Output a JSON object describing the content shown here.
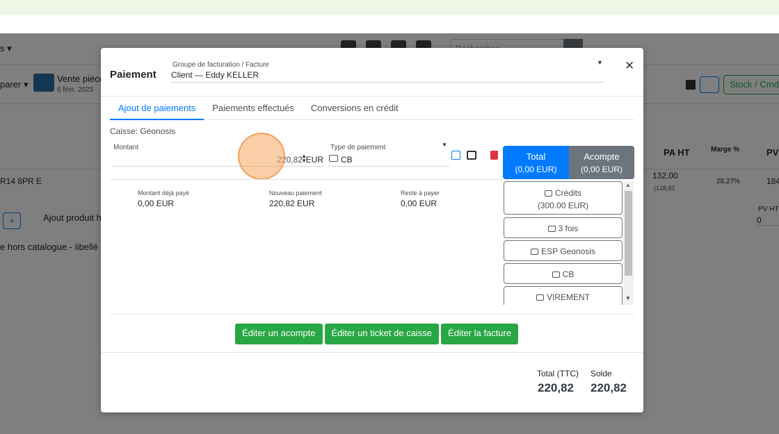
{
  "background": {
    "menu_label": "s ▾",
    "search_placeholder": "Rechercher",
    "comparer_label": "parer ▾",
    "vente_title": "Vente pièce",
    "vente_date": "6 févr. 2025",
    "stock_button": "Stock / Cmd",
    "columns": {
      "pa_ht": "PA HT",
      "marge": "Marge %",
      "pv": "PV"
    },
    "row": {
      "reference": "R14 8PR E",
      "pa_value": "132,00",
      "pa_sub": "(128,82",
      "marge_value": "28,27%",
      "pv_value": "184"
    },
    "ajout_produit": "Ajout produit h",
    "pv_ht_label": "PV HT",
    "pv_ht_value": "0",
    "hors_catalogue": "e hors catalogue - libellé"
  },
  "modal": {
    "title": "Paiement",
    "group_label": "Groupe de facturation / Facture",
    "group_value": "Client — Eddy KELLER",
    "close_icon": "close-icon",
    "tabs": [
      {
        "label": "Ajout de paiements",
        "active": true
      },
      {
        "label": "Paiements effectués",
        "active": false
      },
      {
        "label": "Conversions en crédit",
        "active": false
      }
    ],
    "caisse": "Caisse: Géonosis",
    "montant_label": "Montant",
    "montant_value": "220,82",
    "currency": "EUR",
    "type_label": "Type de paiement",
    "type_value": "CB",
    "total_button": {
      "label": "Total",
      "amount": "(0,00 EUR)"
    },
    "acompte_button": {
      "label": "Acompte",
      "amount": "(0,00 EUR)"
    },
    "summary": [
      {
        "label": "Montant déjà payé",
        "value": "0,00 EUR"
      },
      {
        "label": "Nouveau paiement",
        "value": "220,82 EUR"
      },
      {
        "label": "Reste à payer",
        "value": "0,00 EUR"
      }
    ],
    "payment_methods": [
      {
        "label": "Crédits",
        "sub": "(300.00 EUR)",
        "icon": "receipt-icon"
      },
      {
        "label": "3 fois",
        "icon": "card-icon"
      },
      {
        "label": "ESP Geonosis",
        "icon": "cash-icon"
      },
      {
        "label": "CB",
        "icon": "card-reader-icon"
      },
      {
        "label": "VIREMENT",
        "icon": "bank-icon"
      }
    ],
    "actions": {
      "acompte": "Éditer un acompte",
      "ticket": "Éditer un ticket de caisse",
      "facture": "Éditer la facture"
    },
    "footer": {
      "total_label": "Total (TTC)",
      "total_value": "220,82",
      "solde_label": "Solde",
      "solde_value": "220,82"
    }
  },
  "colors": {
    "primary": "#007bff",
    "secondary": "#6c757d",
    "success": "#28a745",
    "danger": "#dc3545",
    "click_marker": "#f5a65c"
  }
}
